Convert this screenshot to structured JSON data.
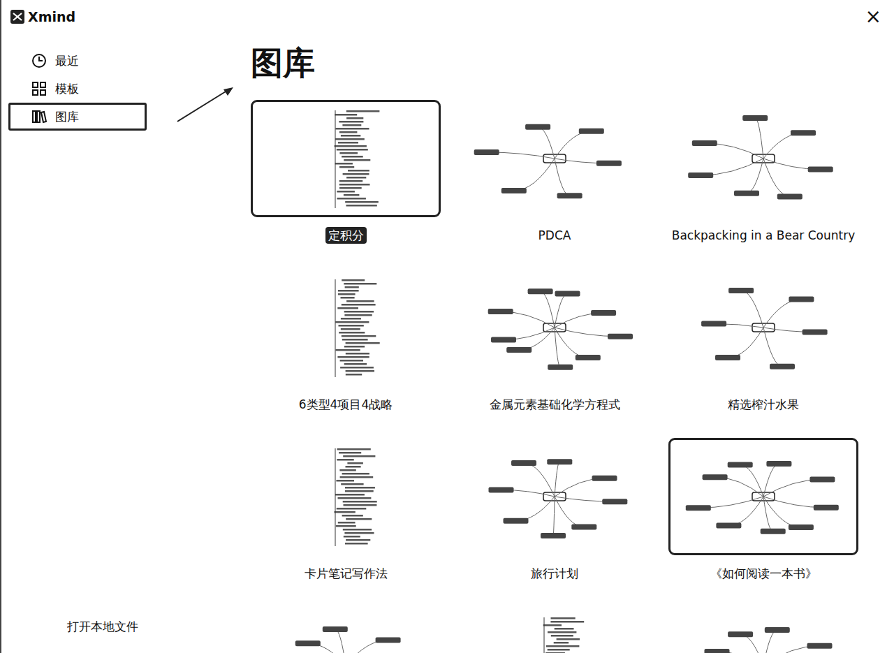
{
  "window": {
    "title": "Xmind",
    "close": "×"
  },
  "sidebar": {
    "items": [
      {
        "label": "最近",
        "selected": false
      },
      {
        "label": "模板",
        "selected": false
      },
      {
        "label": "图库",
        "selected": true
      }
    ],
    "footer": "打开本地文件"
  },
  "gallery": {
    "heading": "图库",
    "items": [
      {
        "label": "定积分",
        "selected": true,
        "hovered": false
      },
      {
        "label": "PDCA",
        "selected": false,
        "hovered": false
      },
      {
        "label": "Backpacking in a Bear Country",
        "selected": false,
        "hovered": false
      },
      {
        "label": "6类型4项目4战略",
        "selected": false,
        "hovered": false
      },
      {
        "label": "金属元素基础化学方程式",
        "selected": false,
        "hovered": false
      },
      {
        "label": "精选榨汁水果",
        "selected": false,
        "hovered": false
      },
      {
        "label": "卡片笔记写作法",
        "selected": false,
        "hovered": false
      },
      {
        "label": "旅行计划",
        "selected": false,
        "hovered": false
      },
      {
        "label": "《如何阅读一本书》",
        "selected": false,
        "hovered": true
      }
    ],
    "partial_items": [
      {
        "selected": false,
        "hovered": false
      },
      {
        "selected": false,
        "hovered": false
      },
      {
        "selected": false,
        "hovered": false
      }
    ]
  }
}
